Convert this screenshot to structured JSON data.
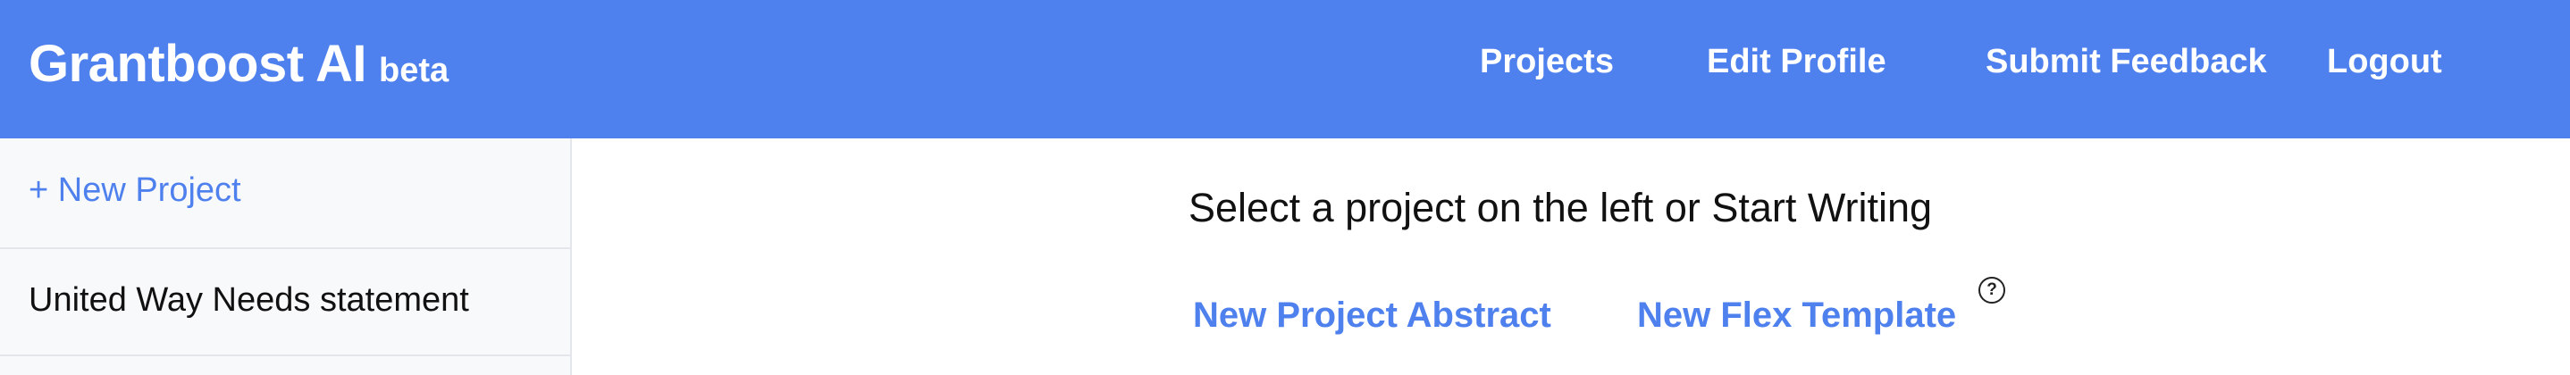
{
  "header": {
    "brand_name": "Grantboost AI",
    "brand_badge": "beta",
    "nav": {
      "projects": "Projects",
      "edit_profile": "Edit Profile",
      "submit_feedback": "Submit Feedback",
      "logout": "Logout"
    }
  },
  "sidebar": {
    "new_project_label": "+ New Project",
    "items": [
      {
        "label": "United Way Needs statement"
      }
    ]
  },
  "main": {
    "prompt": "Select a project on the left or Start Writing",
    "templates": {
      "abstract_label": "New Project Abstract",
      "flex_label": "New Flex Template"
    },
    "help_icon_glyph": "?"
  },
  "colors": {
    "header_bg": "#4f81ee",
    "link": "#4f81ee",
    "sidebar_bg": "#f8f9fa"
  }
}
